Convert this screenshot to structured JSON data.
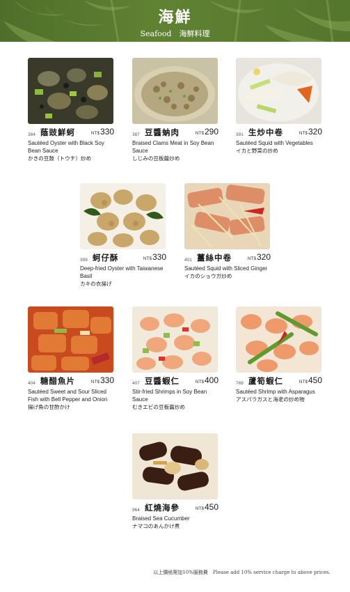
{
  "header": {
    "title": "海鮮",
    "subtitle": "Seafood　海鮮料理"
  },
  "currency": "NT$",
  "items": [
    {
      "number": "384",
      "name_cn": "蔭豉鮮蚵",
      "price": "330",
      "name_en": "Sautéed Oyster with Black Soy Bean Sauce",
      "name_jp": "かきの豆鼓（トウチ）炒め",
      "photo": "oyster-black-bean-photo"
    },
    {
      "number": "387",
      "name_cn": "豆醬蚋肉",
      "price": "290",
      "name_en": "Braised Clams Meat in Soy Bean Sauce",
      "name_jp": "しじみの豆板醤炒め",
      "photo": "clams-photo"
    },
    {
      "number": "391",
      "name_cn": "生炒中卷",
      "price": "320",
      "name_en": "Sautéed Squid with Vegetables",
      "name_jp": "イカと野菜の炒め",
      "photo": "squid-vegetables-photo"
    },
    {
      "number": "399",
      "name_cn": "蚵仔酥",
      "price": "330",
      "name_en": "Deep-fried Oyster with Taiwanese Basil",
      "name_jp": "カキの衣揚げ",
      "photo": "fried-oyster-photo"
    },
    {
      "number": "401",
      "name_cn": "薑絲中卷",
      "price": "320",
      "name_en": "Sautéed Squid with Sliced Ginger",
      "name_jp": "イカのショウガ炒め",
      "photo": "squid-ginger-photo"
    },
    {
      "number": "404",
      "name_cn": "糖醋魚片",
      "price": "330",
      "name_en": "Sautéed Sweet and Sour Sliced Fish with Bell Pepper and Onion",
      "name_jp": "揚げ魚の甘酢かけ",
      "photo": "sweet-sour-fish-photo"
    },
    {
      "number": "407",
      "name_cn": "豆醬蝦仁",
      "price": "400",
      "name_en": "Stir-fried Shrimps in Soy Bean Sauce",
      "name_jp": "むきエビの豆板醤炒め",
      "photo": "shrimp-soybean-photo"
    },
    {
      "number": "768",
      "name_cn": "蘆筍蝦仁",
      "price": "450",
      "name_en": "Sautéed Shrimp with Asparagus",
      "name_jp": "アスパラガスと海老の炒め物",
      "photo": "shrimp-asparagus-photo"
    },
    {
      "number": "964",
      "name_cn": "紅燒海參",
      "price": "450",
      "name_en": "Braised Sea Cucumber",
      "name_jp": "ナマコのあんかけ煮",
      "photo": "sea-cucumber-photo"
    }
  ],
  "footer": "以上價格需加10%服務費　Please add 10% service charge to above prices."
}
